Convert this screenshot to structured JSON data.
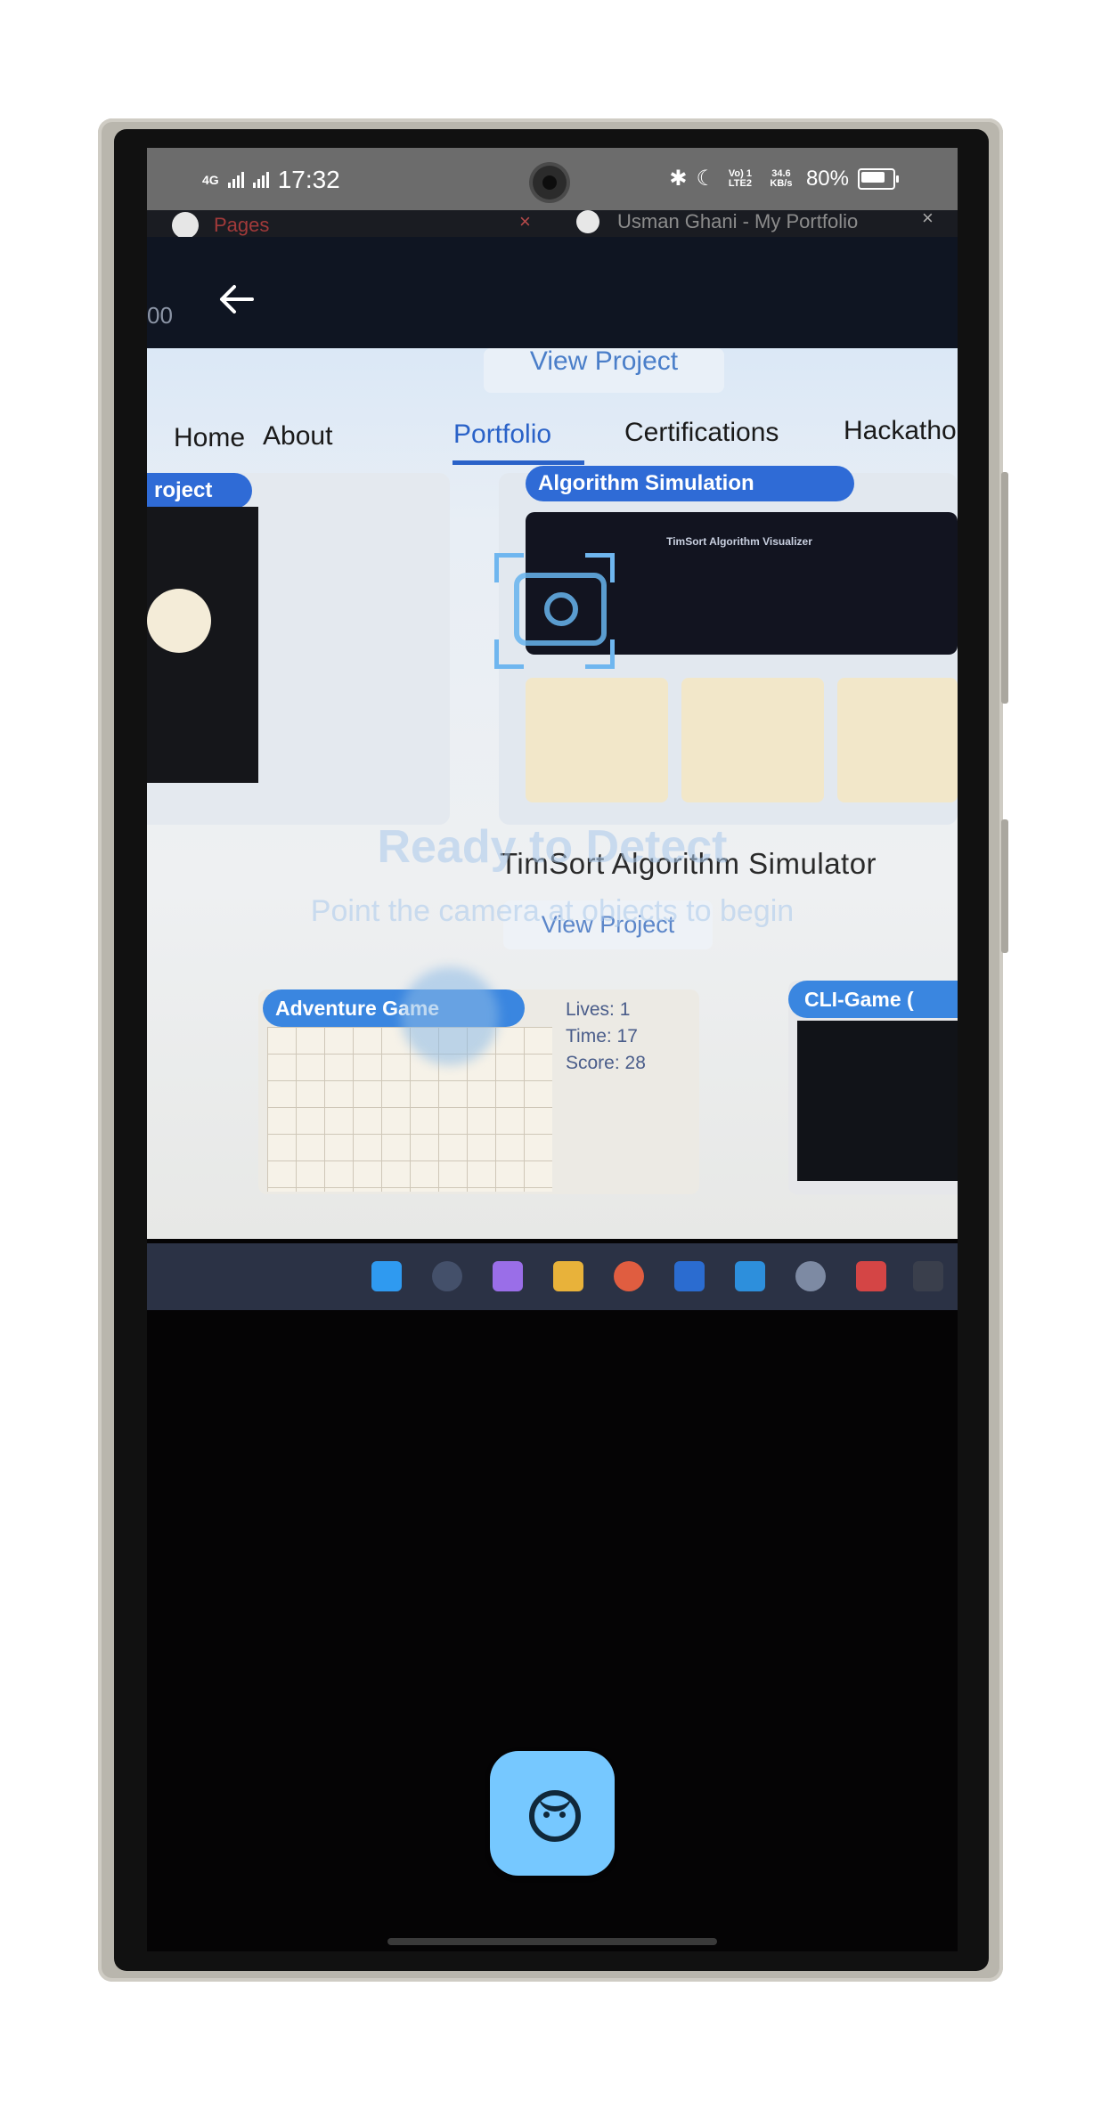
{
  "status_bar": {
    "network": "4G",
    "time": "17:32",
    "volte": "Vo) 1 LTE2",
    "speed": "34.6 KB/s",
    "battery": "80%"
  },
  "browser": {
    "tab1": "Pages",
    "tab2": "Usman Ghani - My Portfolio",
    "close": "×"
  },
  "preview": {
    "counter": "00",
    "view_project_top": "View Project",
    "nav": [
      "Home",
      "About",
      "Portfolio",
      "Certifications",
      "Hackathon"
    ],
    "left_badge": "roject",
    "mid_badge": "Algorithm Simulation",
    "mid_shot_title": "TimSort Algorithm Visualizer",
    "project_title": "TimSort Algorithm Simulator",
    "view_project_mid": "View Project",
    "game_badge": "Adventure Game",
    "game_stats": [
      "Lives: 1",
      "Time: 17",
      "Score: 28"
    ],
    "cli_badge": "CLI-Game ("
  },
  "overlay": {
    "title": "Ready to Detect",
    "subtitle": "Point the camera at objects to begin"
  },
  "actions": {
    "face_button_icon": "face-icon"
  },
  "colors": {
    "accent": "#76c8ff",
    "nav_active": "#2a62c8",
    "badge": "#2f6bd6"
  }
}
